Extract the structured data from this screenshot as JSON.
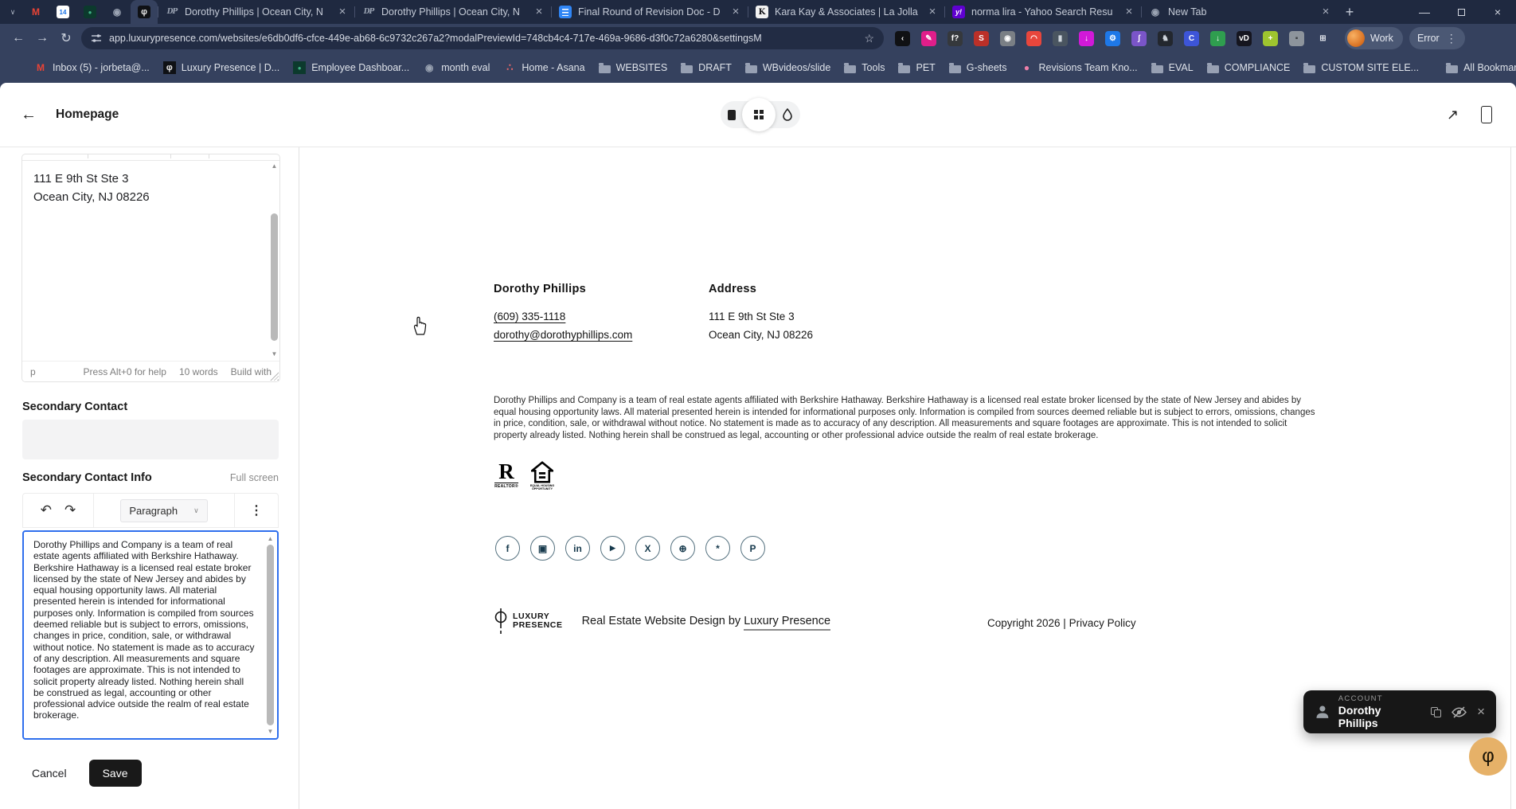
{
  "browser": {
    "pinned_tabs": [
      {
        "icon": "gmail"
      },
      {
        "icon": "calendar"
      },
      {
        "icon": "greenhouse"
      },
      {
        "icon": "globe"
      },
      {
        "icon": "luxury-presence"
      }
    ],
    "tabs": [
      {
        "icon": "dp",
        "title": "Dorothy Phillips | Ocean City, N"
      },
      {
        "icon": "dp",
        "title": "Dorothy Phillips | Ocean City, N"
      },
      {
        "icon": "docs",
        "title": "Final Round of Revision Doc - D"
      },
      {
        "icon": "kk",
        "title": "Kara Kay & Associates | La Jolla"
      },
      {
        "icon": "yahoo",
        "title": "norma lira - Yahoo Search Resu"
      },
      {
        "icon": "globe",
        "title": "New Tab"
      }
    ],
    "url": "app.luxurypresence.com/websites/e6db0df6-cfce-449e-ab68-6c9732c267a2?modalPreviewId=748cb4c4-717e-469a-9686-d3f0c72a6280&settingsM",
    "profile_label": "Work",
    "menu_label": "Error",
    "extensions": [
      {
        "name": "back-circle-extension",
        "glyph": "‹",
        "bg": "#101114",
        "fg": "#ffffff"
      },
      {
        "name": "pen-extension",
        "glyph": "✎",
        "bg": "#e01e8a",
        "fg": "#ffffff"
      },
      {
        "name": "font-finder-extension",
        "glyph": "f?",
        "bg": "#35383c",
        "fg": "#ffffff"
      },
      {
        "name": "red-s-extension",
        "glyph": "S",
        "bg": "#bb3028",
        "fg": "#ffffff"
      },
      {
        "name": "camera-extension",
        "glyph": "◉",
        "bg": "#7a7f85",
        "fg": "#ffffff"
      },
      {
        "name": "shopping-extension",
        "glyph": "◠",
        "bg": "#e8463c",
        "fg": "#ffffff"
      },
      {
        "name": "utility-extension",
        "glyph": "▮",
        "bg": "#4a5560",
        "fg": "#cfd6dd"
      },
      {
        "name": "magenta-down-extension",
        "glyph": "↓",
        "bg": "#d219d8",
        "fg": "#ffffff"
      },
      {
        "name": "blue-gear-extension",
        "glyph": "⚙",
        "bg": "#1e78e8",
        "fg": "#ffffff"
      },
      {
        "name": "quill-extension",
        "glyph": "ʃ",
        "bg": "#7a55c8",
        "fg": "#ffffff"
      },
      {
        "name": "cat-extension",
        "glyph": "♞",
        "bg": "#23272e",
        "fg": "#cdd3da"
      },
      {
        "name": "blue-c-extension",
        "glyph": "C",
        "bg": "#3d55d8",
        "fg": "#ffffff"
      },
      {
        "name": "green-down-extension",
        "glyph": "↓",
        "bg": "#2f9e4f",
        "fg": "#ffffff"
      },
      {
        "name": "vd-extension",
        "glyph": "vD",
        "bg": "#15151f",
        "fg": "#ffffff"
      },
      {
        "name": "color-plus-extension",
        "glyph": "+",
        "bg": "#9ec52f",
        "fg": "#ffffff"
      },
      {
        "name": "shield-extension",
        "glyph": "▪",
        "bg": "#8d949c",
        "fg": "#3c4043"
      },
      {
        "name": "puzzle-extension",
        "glyph": "⊞",
        "bg": "transparent",
        "fg": "#dfe3ea"
      }
    ],
    "bookmarks": [
      {
        "icon": "gmail",
        "label": "Inbox (5) - jorbeta@..."
      },
      {
        "icon": "luxury-presence",
        "label": "Luxury Presence | D..."
      },
      {
        "icon": "greenhouse",
        "label": "Employee Dashboar..."
      },
      {
        "icon": "globe",
        "label": "month eval"
      },
      {
        "icon": "asana",
        "label": "Home - Asana"
      },
      {
        "icon": "folder",
        "label": "WEBSITES"
      },
      {
        "icon": "folder",
        "label": "DRAFT"
      },
      {
        "icon": "folder",
        "label": "WBvideos/slide"
      },
      {
        "icon": "folder",
        "label": "Tools"
      },
      {
        "icon": "folder",
        "label": "PET"
      },
      {
        "icon": "folder",
        "label": "G-sheets"
      },
      {
        "icon": "chat",
        "label": "Revisions Team Kno..."
      },
      {
        "icon": "folder",
        "label": "EVAL"
      },
      {
        "icon": "folder",
        "label": "COMPLIANCE"
      },
      {
        "icon": "folder",
        "label": "CUSTOM SITE ELE..."
      }
    ],
    "all_bookmarks_label": "All Bookmarks"
  },
  "editor_app": {
    "page_title": "Homepage",
    "sidebar": {
      "address_line1": "111 E 9th St Ste 3",
      "address_line2": "Ocean City, NJ 08226",
      "status_path": "p",
      "status_help": "Press Alt+0 for help",
      "status_words": "10 words",
      "status_brand": "Build with",
      "secondary_contact_label": "Secondary Contact",
      "secondary_contact_info_label": "Secondary Contact Info",
      "full_screen_label": "Full screen",
      "paragraph_label": "Paragraph",
      "cancel_label": "Cancel",
      "save_label": "Save"
    }
  },
  "disclaimer_text": "Dorothy Phillips and Company is a team of real estate agents affiliated with Berkshire Hathaway. Berkshire Hathaway is a licensed real estate broker licensed by the state of New Jersey and abides by equal housing opportunity laws. All material presented herein is intended for informational purposes only. Information is compiled from sources deemed reliable but is subject to errors, omissions, changes in price, condition, sale, or withdrawal without notice. No statement is made as to accuracy of any description. All measurements and square footages are approximate. This is not intended to solicit property already listed. Nothing herein shall be construed as legal, accounting or other professional advice outside the realm of real estate brokerage.",
  "preview": {
    "contact_name": "Dorothy Phillips",
    "phone": "(609) 335-1118",
    "email": "dorothy@dorothyphillips.com",
    "address_heading": "Address",
    "address_line1": "111 E 9th St Ste 3",
    "address_line2": "Ocean City, NJ 08226",
    "realtor_caption": "REALTOR®",
    "eho_caption": "EQUAL HOUSING OPPORTUNITY",
    "social": [
      {
        "name": "facebook",
        "glyph": "f"
      },
      {
        "name": "instagram",
        "glyph": "▣"
      },
      {
        "name": "linkedin",
        "glyph": "in"
      },
      {
        "name": "youtube",
        "glyph": "▶"
      },
      {
        "name": "x-twitter",
        "glyph": "X"
      },
      {
        "name": "realtor",
        "glyph": "⊕"
      },
      {
        "name": "yelp",
        "glyph": "*"
      },
      {
        "name": "pinterest",
        "glyph": "P"
      }
    ],
    "footer": {
      "brand_top": "LUXURY",
      "brand_bottom": "PRESENCE",
      "design_prefix": "Real Estate Website Design by ",
      "design_link": "Luxury Presence",
      "copyright": "Copyright 2026 | Privacy Policy"
    }
  },
  "account_toast": {
    "kicker": "ACCOUNT",
    "name": "Dorothy Phillips"
  },
  "colors": {
    "accent_blue": "#2f6fed",
    "save_black": "#191919",
    "fab_gold": "#e6b168",
    "toast_bg": "#171717",
    "chrome_dark": "#1f2940",
    "chrome_toolbar": "#35415e"
  }
}
